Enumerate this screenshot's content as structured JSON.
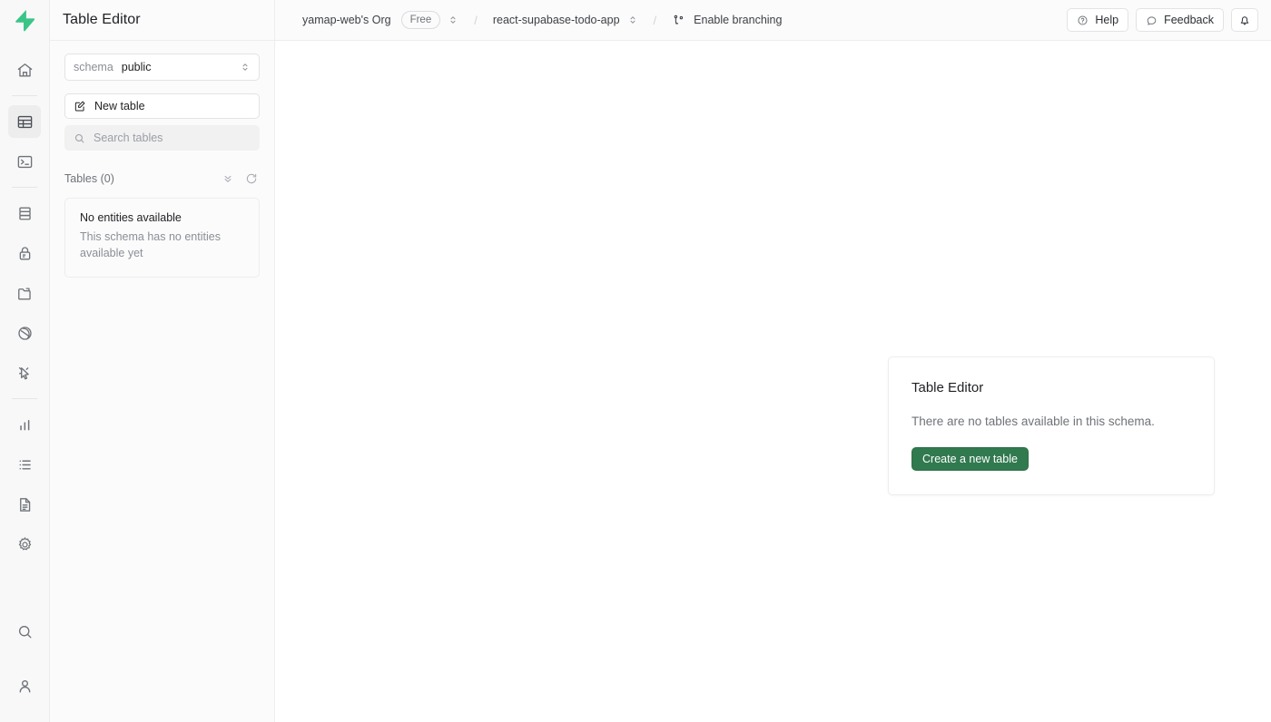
{
  "app": {
    "logo_icon": "supabase-bolt-logo",
    "brand_color": "#3ecf8e"
  },
  "rail": {
    "items": [
      {
        "name": "home",
        "icon": "home-icon",
        "active": false
      },
      {
        "name": "table-editor",
        "icon": "table-icon",
        "active": true
      },
      {
        "name": "sql-editor",
        "icon": "terminal-icon",
        "active": false
      },
      {
        "name": "database",
        "icon": "database-icon",
        "active": false
      },
      {
        "name": "authentication",
        "icon": "lock-icon",
        "active": false
      },
      {
        "name": "storage",
        "icon": "folder-icon",
        "active": false
      },
      {
        "name": "realtime",
        "icon": "realtime-icon",
        "active": false
      },
      {
        "name": "edge-functions",
        "icon": "edge-functions-icon",
        "active": false
      },
      {
        "name": "reports",
        "icon": "bar-chart-icon",
        "active": false
      },
      {
        "name": "logs",
        "icon": "list-icon",
        "active": false
      },
      {
        "name": "api-docs",
        "icon": "document-icon",
        "active": false
      },
      {
        "name": "project-settings",
        "icon": "gear-icon",
        "active": false
      }
    ],
    "bottom_items": [
      {
        "name": "search",
        "icon": "search-icon"
      },
      {
        "name": "account",
        "icon": "user-icon"
      }
    ]
  },
  "header": {
    "title": "Table Editor"
  },
  "topbar": {
    "org_name": "yamap-web's Org",
    "plan_badge": "Free",
    "project_name": "react-supabase-todo-app",
    "separator": "/",
    "branching_label": "Enable branching",
    "branching_icon": "git-branch-icon",
    "help_label": "Help",
    "help_icon": "question-circle-icon",
    "feedback_label": "Feedback",
    "feedback_icon": "chat-bubble-icon",
    "notifications_icon": "bell-icon"
  },
  "sidebar": {
    "schema": {
      "label": "schema",
      "value": "public",
      "chevron_icon": "chevron-up-down-icon"
    },
    "new_table": {
      "label": "New table",
      "icon": "edit-square-icon"
    },
    "search": {
      "placeholder": "Search tables",
      "value": "",
      "icon": "search-icon"
    },
    "tables_header": {
      "label": "Tables (0)",
      "collapse_icon": "chevrons-down-icon",
      "refresh_icon": "refresh-icon"
    },
    "empty_entities": {
      "title": "No entities available",
      "description": "This schema has no entities available yet"
    }
  },
  "main": {
    "empty_card": {
      "title": "Table Editor",
      "description": "There are no tables available in this schema.",
      "button_label": "Create a new table",
      "button_color": "#31794f"
    }
  }
}
